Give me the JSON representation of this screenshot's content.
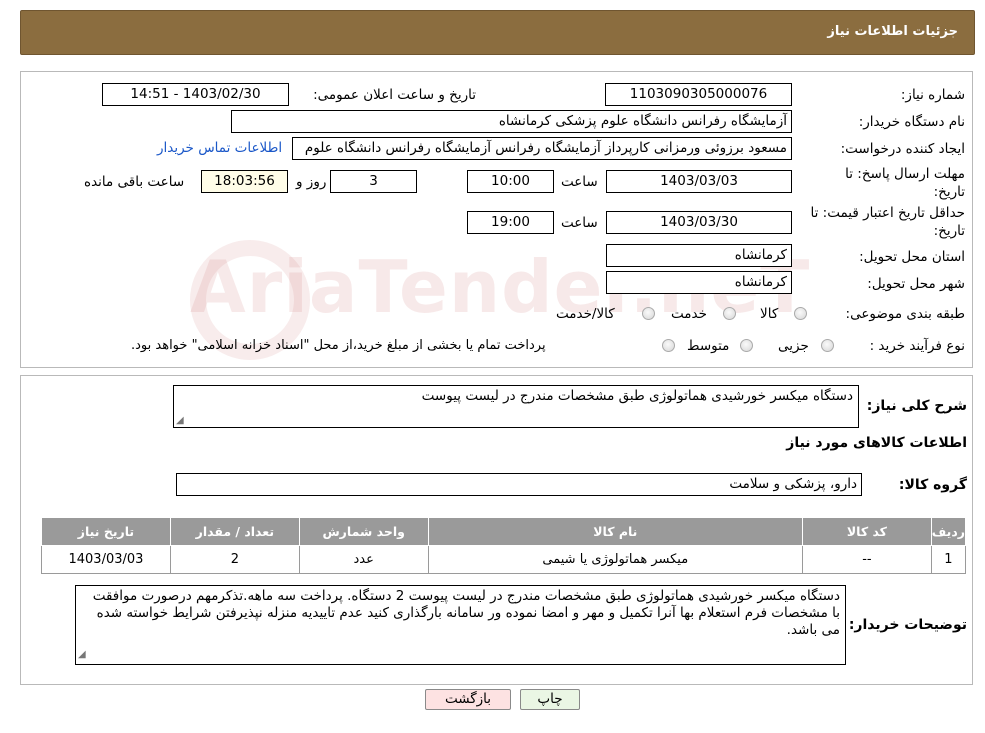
{
  "header": {
    "title": "جزئیات اطلاعات نیاز"
  },
  "form": {
    "need_number_label": "شماره نیاز:",
    "need_number": "1103090305000076",
    "announce_label": "تاریخ و ساعت اعلان عمومی:",
    "announce_value": "1403/02/30 - 14:51",
    "buyer_org_label": "نام دستگاه خریدار:",
    "buyer_org": "آزمایشگاه رفرانس دانشگاه علوم پزشکی کرمانشاه",
    "creator_label": "ایجاد کننده درخواست:",
    "creator": "مسعود برزوئی ورمزانی کارپرداز آزمایشگاه رفرانس آزمایشگاه رفرانس دانشگاه علوم",
    "contact_link": "اطلاعات تماس خریدار",
    "deadline_label_1": "مهلت ارسال پاسخ: تا",
    "deadline_label_2": "تاریخ:",
    "deadline_date": "1403/03/03",
    "time_label": "ساعت",
    "deadline_time": "10:00",
    "days_value": "3",
    "days_label": "روز و",
    "remaining_time": "18:03:56",
    "remaining_label": "ساعت باقی مانده",
    "validity_label_1": "حداقل تاریخ اعتبار قیمت: تا",
    "validity_label_2": "تاریخ:",
    "validity_date": "1403/03/30",
    "validity_time": "19:00",
    "province_label": "استان محل تحویل:",
    "province": "کرمانشاه",
    "city_label": "شهر محل تحویل:",
    "city": "کرمانشاه",
    "category_label": "طبقه بندی موضوعی:",
    "category_options": [
      "کالا",
      "خدمت",
      "کالا/خدمت"
    ],
    "process_label": "نوع فرآیند خرید :",
    "process_options": [
      "جزیی",
      "متوسط"
    ],
    "process_note": "پرداخت تمام یا بخشی از مبلغ خرید،از محل \"اسناد خزانه اسلامی\" خواهد بود."
  },
  "details": {
    "summary_label": "شرح کلی نیاز:",
    "summary": "دستگاه میکسر خورشیدی هماتولوژی طبق مشخصات مندرج در لیست پیوست",
    "goods_info_title": "اطلاعات کالاهای مورد نیاز",
    "group_label": "گروه کالا:",
    "group_value": "دارو، پزشکی و سلامت",
    "table": {
      "headers": [
        "ردیف",
        "کد کالا",
        "نام کالا",
        "واحد شمارش",
        "تعداد / مقدار",
        "تاریخ نیاز"
      ],
      "rows": [
        [
          "1",
          "--",
          "میکسر هماتولوژی یا شیمی",
          "عدد",
          "2",
          "1403/03/03"
        ]
      ]
    },
    "buyer_notes_label": "توضیحات خریدار:",
    "buyer_notes": "دستگاه میکسر خورشیدی هماتولوژی طبق مشخصات مندرج در لیست پیوست 2 دستگاه. پرداخت سه ماهه.تذکرمهم درصورت موافقت با مشخصات فرم استعلام بها آنرا تکمیل و مهر و امضا نموده ور سامانه بارگذاری کنید عدم تاییدیه منزله نپذیرفتن شرایط خواسته شده می باشد."
  },
  "buttons": {
    "print": "چاپ",
    "back": "بازگشت"
  },
  "watermark": {
    "text": "AriaTender.neT"
  },
  "colors": {
    "header_bg": "#8b6d3f",
    "table_header_bg": "#9a9a9a",
    "link": "#1a57c8",
    "back_button_bg": "#fde2e2",
    "print_button_bg": "#eaf6e4"
  }
}
